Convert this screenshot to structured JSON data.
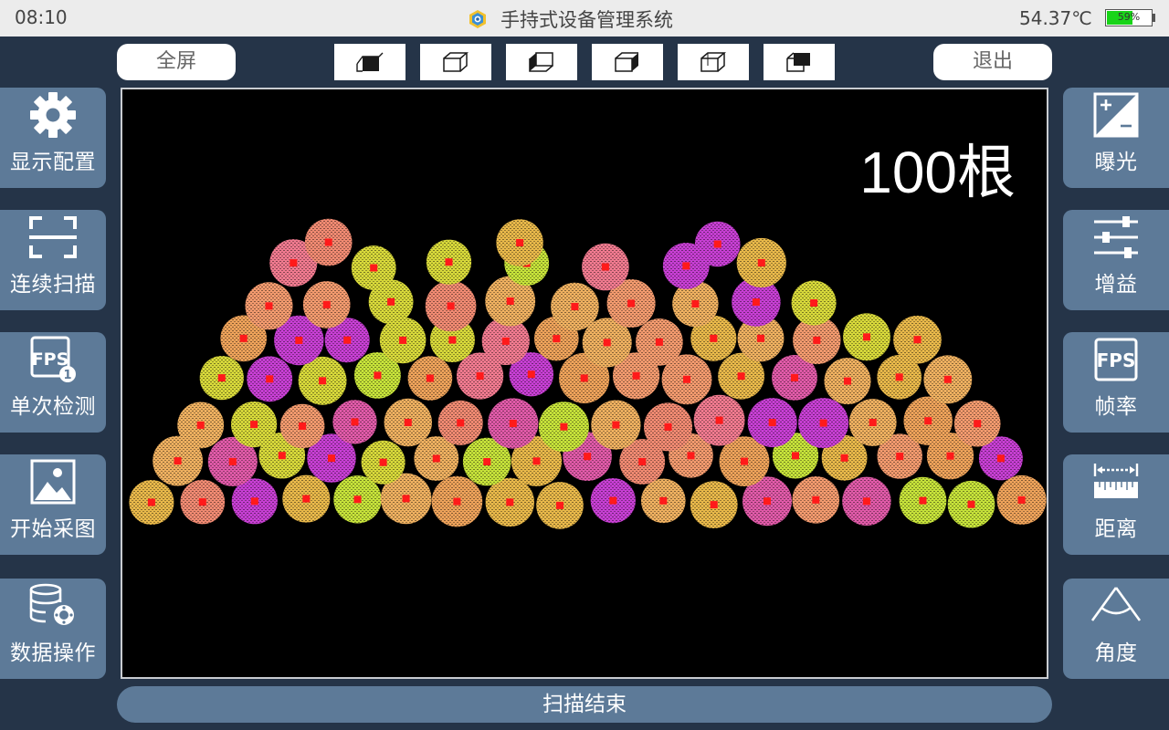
{
  "statusbar": {
    "time": "08:10",
    "app_title": "手持式设备管理系统",
    "temperature": "54.37℃",
    "battery_text": "59%",
    "battery_level": 0.59
  },
  "toolbar": {
    "fullscreen_label": "全屏",
    "exit_label": "退出",
    "view_buttons": [
      "cube-front-icon",
      "cube-outline-icon",
      "cube-left-icon",
      "cube-right-icon",
      "cube-top-icon",
      "cube-back-icon"
    ]
  },
  "left_panel": [
    {
      "label": "显示配置",
      "icon": "gear-icon"
    },
    {
      "label": "连续扫描",
      "icon": "scan-frame-icon"
    },
    {
      "label": "单次检测",
      "icon": "fps-single-icon"
    },
    {
      "label": "开始采图",
      "icon": "image-icon"
    },
    {
      "label": "数据操作",
      "icon": "database-gear-icon"
    }
  ],
  "right_panel": [
    {
      "label": "曝光",
      "icon": "exposure-icon"
    },
    {
      "label": "增益",
      "icon": "sliders-icon"
    },
    {
      "label": "帧率",
      "icon": "fps-icon"
    },
    {
      "label": "距离",
      "icon": "ruler-icon"
    },
    {
      "label": "角度",
      "icon": "angle-icon"
    }
  ],
  "viewer": {
    "count_label": "100根",
    "count": 100
  },
  "status": {
    "text": "扫描结束"
  },
  "colors": {
    "panel": "#5d7a98",
    "background": "#253448",
    "marker": "#ff1a1a",
    "blob_palette": [
      "#f29a6e",
      "#eda25a",
      "#e8b84a",
      "#d7d83a",
      "#c6e23a",
      "#f07a8f",
      "#e05aa8",
      "#c73fd3",
      "#f08a72",
      "#eeb060"
    ]
  }
}
